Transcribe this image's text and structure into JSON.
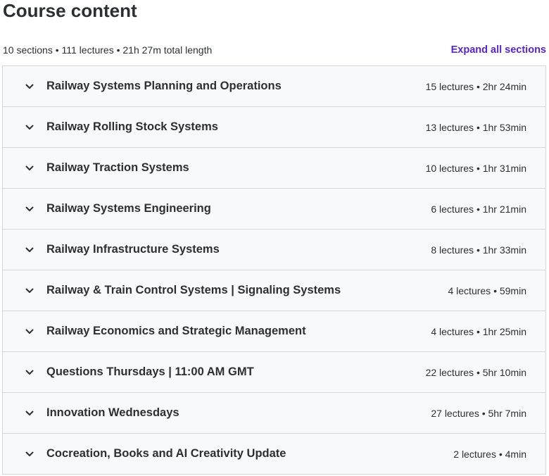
{
  "header": {
    "title": "Course content",
    "summary": "10 sections • 111 lectures • 21h 27m total length",
    "expand_label": "Expand all sections"
  },
  "icons": {
    "section_toggle": "chevron-down-icon"
  },
  "colors": {
    "accent": "#5624d0",
    "text": "#2d2f31",
    "row_bg": "#f7f9fa",
    "border": "#d1d7dc"
  },
  "sections": [
    {
      "title": "Railway Systems Planning and Operations",
      "info": "15 lectures • 2hr 24min"
    },
    {
      "title": "Railway Rolling Stock Systems",
      "info": "13 lectures • 1hr 53min"
    },
    {
      "title": "Railway Traction Systems",
      "info": "10 lectures • 1hr 31min"
    },
    {
      "title": "Railway Systems Engineering",
      "info": "6 lectures • 1hr 21min"
    },
    {
      "title": "Railway Infrastructure Systems",
      "info": "8 lectures • 1hr 33min"
    },
    {
      "title": "Railway & Train Control Systems | Signaling Systems",
      "info": "4 lectures • 59min"
    },
    {
      "title": "Railway Economics and Strategic Management",
      "info": "4 lectures • 1hr 25min"
    },
    {
      "title": "Questions Thursdays | 11:00 AM GMT",
      "info": "22 lectures • 5hr 10min"
    },
    {
      "title": "Innovation Wednesdays",
      "info": "27 lectures • 5hr 7min"
    },
    {
      "title": "Cocreation, Books and AI Creativity Update",
      "info": "2 lectures • 4min"
    }
  ]
}
